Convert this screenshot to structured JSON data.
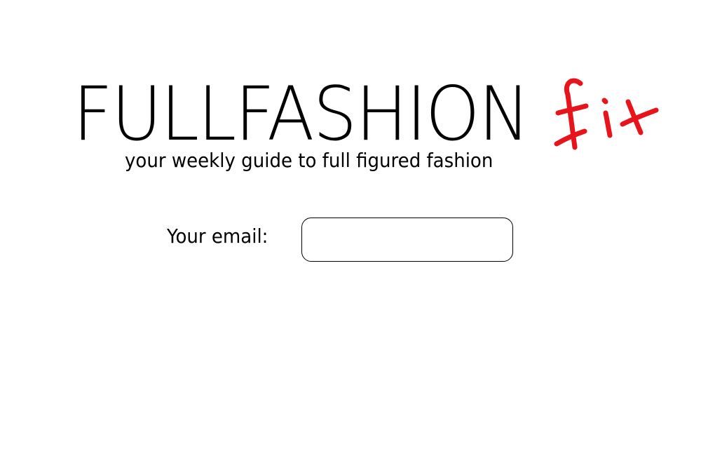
{
  "logo": {
    "main_text": "FULLFASHION",
    "accent_text": "fix",
    "accent_color": "#e8141c"
  },
  "tagline": "your weekly guide to full figured fashion",
  "form": {
    "email_label": "Your email:",
    "email_value": "",
    "email_placeholder": ""
  }
}
